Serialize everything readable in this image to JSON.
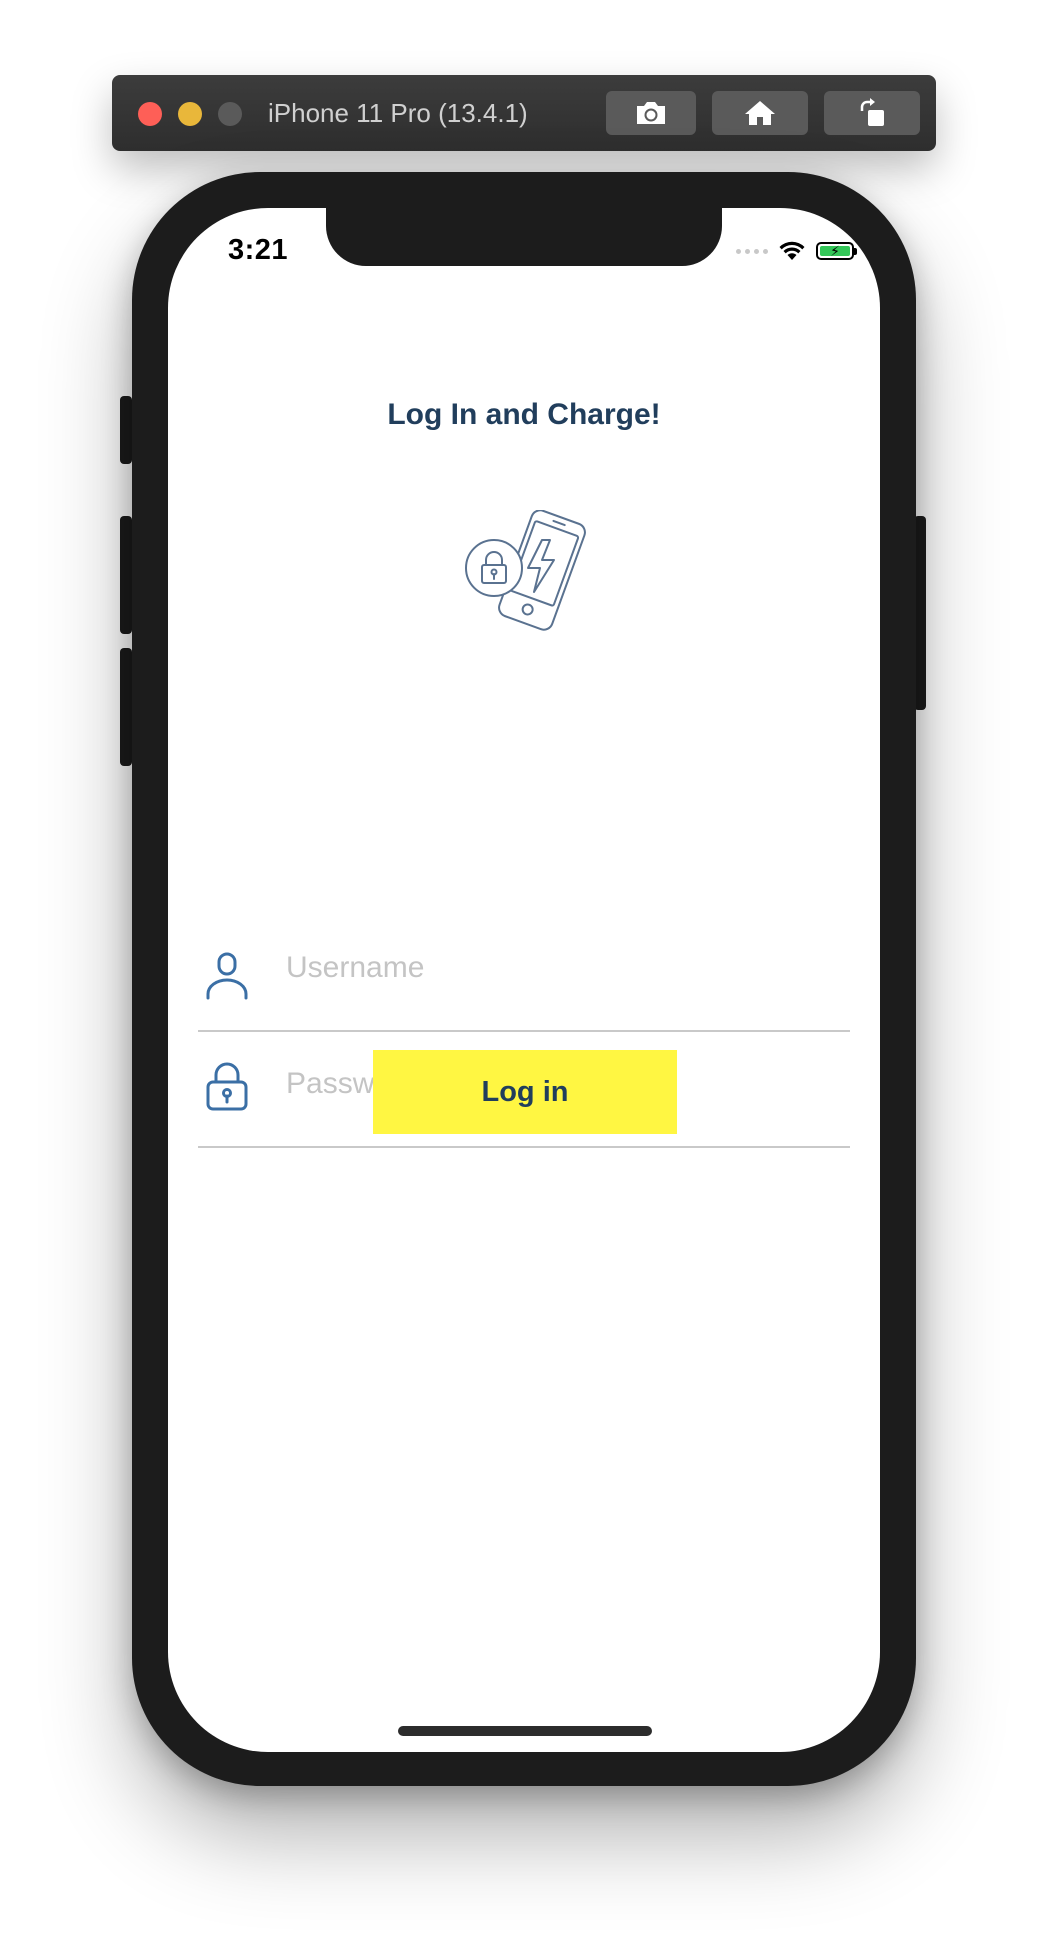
{
  "simulator": {
    "title": "iPhone 11 Pro (13.4.1)",
    "buttons": {
      "screenshot": "camera-icon",
      "home": "home-icon",
      "rotate": "rotate-icon"
    }
  },
  "status_bar": {
    "time": "3:21",
    "wifi_icon": "wifi-icon",
    "battery_icon": "battery-charging-icon"
  },
  "login": {
    "title": "Log In and Charge!",
    "hero_icon": "phone-lock-charge-icon",
    "username": {
      "placeholder": "Username",
      "value": "",
      "icon": "user-icon"
    },
    "password": {
      "placeholder": "Password",
      "value": "",
      "icon": "lock-icon"
    },
    "submit_label": "Log in"
  },
  "colors": {
    "brand_dark": "#213e5c",
    "icon_blue": "#3b6fa5",
    "button_yellow": "#fff642",
    "placeholder": "#c4c4c4",
    "divider": "#c9c9c9"
  }
}
